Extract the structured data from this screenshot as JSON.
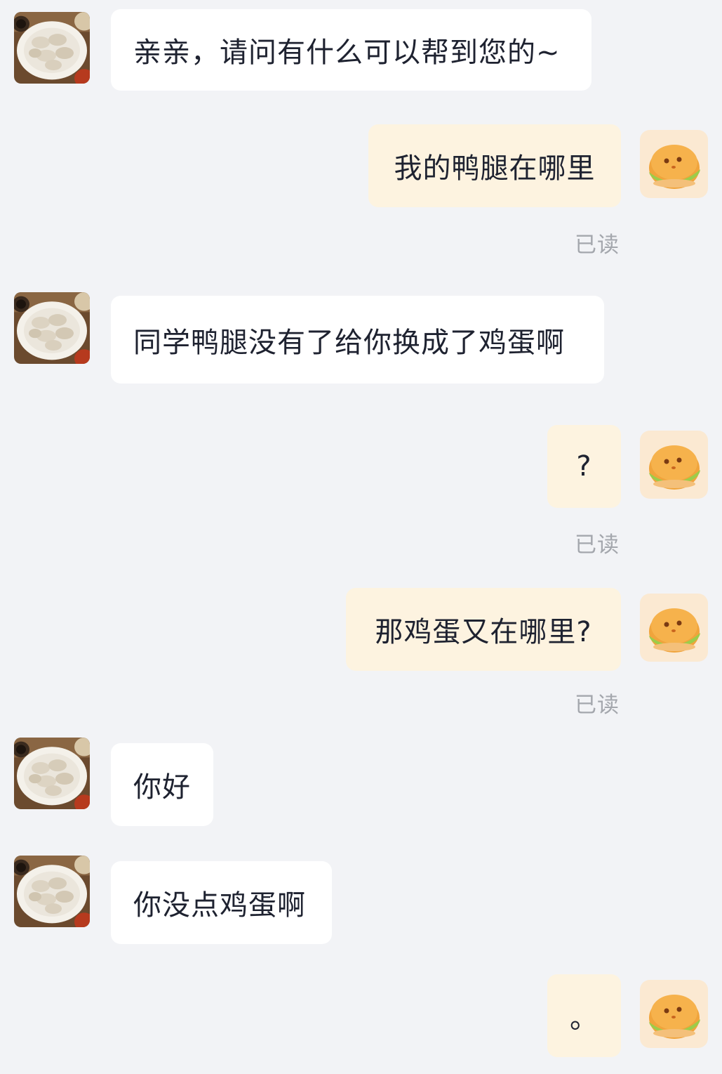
{
  "messages": [
    {
      "side": "left",
      "avatar": "dumplings-avatar",
      "text": "亲亲，请问有什么可以帮到您的~"
    },
    {
      "side": "right",
      "avatar": "bun-avatar",
      "text": "我的鸭腿在哪里",
      "read": "已读"
    },
    {
      "side": "left",
      "avatar": "dumplings-avatar",
      "text": "同学鸭腿没有了给你换成了鸡蛋啊"
    },
    {
      "side": "right",
      "avatar": "bun-avatar",
      "text": "?",
      "read": "已读"
    },
    {
      "side": "right",
      "avatar": "bun-avatar",
      "text": "那鸡蛋又在哪里?",
      "read": "已读"
    },
    {
      "side": "left",
      "avatar": "dumplings-avatar",
      "text": "你好"
    },
    {
      "side": "left",
      "avatar": "dumplings-avatar",
      "text": "你没点鸡蛋啊"
    },
    {
      "side": "right",
      "avatar": "bun-avatar",
      "text": "。"
    }
  ],
  "colors": {
    "background": "#f2f3f6",
    "incoming_bubble": "#ffffff",
    "outgoing_bubble": "#fdf3e0",
    "message_text": "#1e2230",
    "read_label": "#a4a7ad"
  }
}
